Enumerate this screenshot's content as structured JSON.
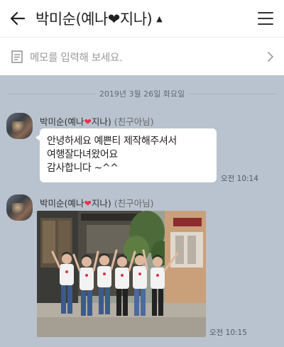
{
  "header": {
    "title": "박미순(예나❤지나)",
    "caret": "▲",
    "back_icon": "arrow-left-icon",
    "menu_icon": "hamburger-menu-icon"
  },
  "memo": {
    "placeholder": "메모를 입력해 보세요.",
    "icon": "note-icon",
    "arrow_icon": "chevron-right-icon"
  },
  "chat": {
    "background": "#b9c3cf",
    "date_divider": "2019년 3월 26일 화요일",
    "messages": [
      {
        "sender_prefix": "박미순(예나",
        "sender_heart": "❤",
        "sender_suffix": "지나)",
        "sender_tag": "(친구아님)",
        "type": "text",
        "lines": [
          "안녕하세요 예쁜티 제작해주셔서",
          "여행잘다녀왔어요",
          "감사합니다 ~^^"
        ],
        "time": "오전 10:14"
      },
      {
        "sender_prefix": "박미순(예나",
        "sender_heart": "❤",
        "sender_suffix": "지나)",
        "sender_tag": "(친구아님)",
        "type": "photo",
        "time": "오전 10:15"
      }
    ]
  }
}
